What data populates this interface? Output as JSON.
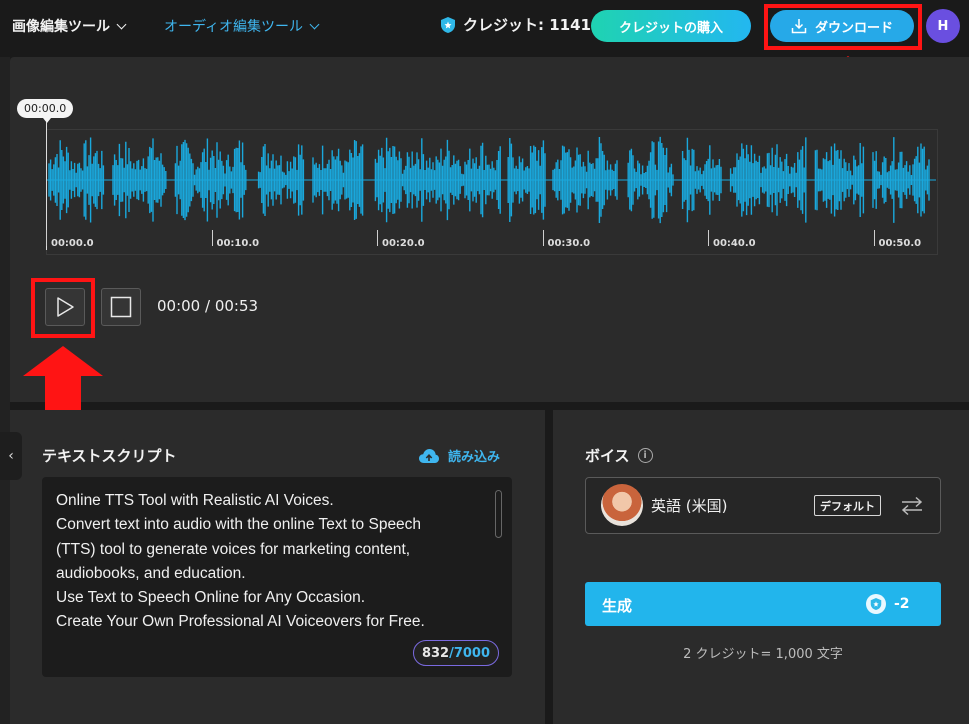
{
  "header": {
    "image_tools_label": "画像編集ツール",
    "audio_tools_label": "オーディオ編集ツール",
    "credits_label": "クレジット: 1141",
    "buy_credits_label": "クレジットの購入",
    "download_label": "ダウンロード",
    "avatar_initial": "H"
  },
  "player": {
    "cursor_time": "00:00.0",
    "ruler_labels": [
      "00:00.0",
      "00:10.0",
      "00:20.0",
      "00:30.0",
      "00:40.0",
      "00:50.0"
    ],
    "time_display": "00:00 / 00:53"
  },
  "script": {
    "title": "テキストスクリプト",
    "load_label": "読み込み",
    "lines": [
      "Online TTS Tool with Realistic AI Voices.",
      "Convert text into audio with the online Text to Speech",
      "(TTS) tool to generate voices for marketing content,",
      "audiobooks, and education.",
      "Use Text to Speech Online for Any Occasion.",
      "Create Your Own Professional AI Voiceovers for Free."
    ],
    "char_count": "832",
    "char_max": "/7000"
  },
  "voice": {
    "title": "ボイス",
    "info_symbol": "i",
    "language": "英語 (米国)",
    "default_badge": "デフォルト",
    "generate_label": "生成",
    "generate_cost": "-2",
    "credit_note": "2 クレジット= 1,000 文字"
  },
  "colors": {
    "accent": "#26a9e8",
    "waveform": "#1aa8dc",
    "highlight": "#ff1414",
    "panel": "#2b2b2b"
  },
  "icons": [
    "chevron-down-icon",
    "credit-shield-icon",
    "download-icon",
    "play-icon",
    "stop-icon",
    "collapse-left-icon",
    "cloud-upload-icon",
    "info-icon",
    "swap-icon"
  ]
}
